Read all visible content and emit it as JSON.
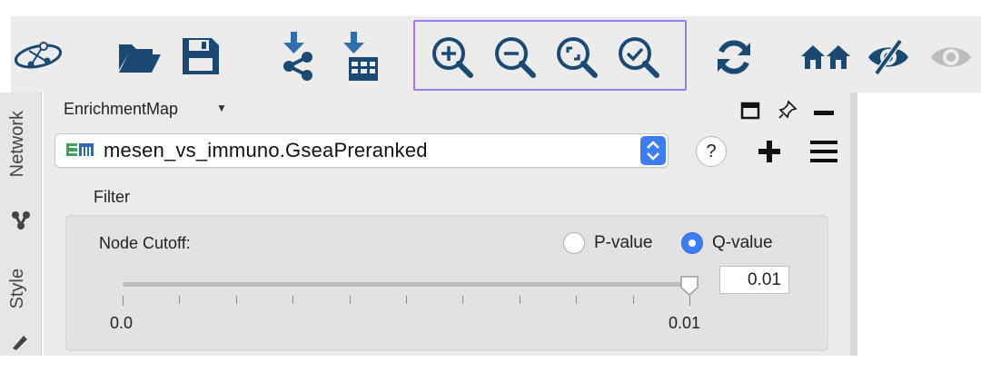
{
  "toolbar": {
    "icons": [
      "cytoscape-logo-icon",
      "open-folder-icon",
      "save-disk-icon",
      "import-network-icon",
      "import-table-icon",
      "zoom-in-icon",
      "zoom-out-icon",
      "zoom-fit-icon",
      "zoom-selected-icon",
      "refresh-icon",
      "home-icon",
      "hide-icon",
      "show-icon"
    ],
    "accent": "#1a4a73",
    "highlight_color": "#9b7cf0"
  },
  "side_tabs": {
    "network": "Network",
    "style": "Style"
  },
  "panel": {
    "title": "EnrichmentMap",
    "selected_analysis": "mesen_vs_immuno.GseaPreranked",
    "help_label": "?"
  },
  "filter": {
    "section_label": "Filter",
    "node_cutoff_label": "Node Cutoff:",
    "options": [
      {
        "label": "P-value",
        "selected": false
      },
      {
        "label": "Q-value",
        "selected": true
      }
    ],
    "slider": {
      "min_label": "0.0",
      "max_label": "0.01",
      "value": "0.01",
      "fraction": 1.0
    }
  },
  "colors": {
    "select_blue": "#3c7ef2",
    "em_green": "#3aa55a",
    "em_blue": "#2b6cb0"
  }
}
